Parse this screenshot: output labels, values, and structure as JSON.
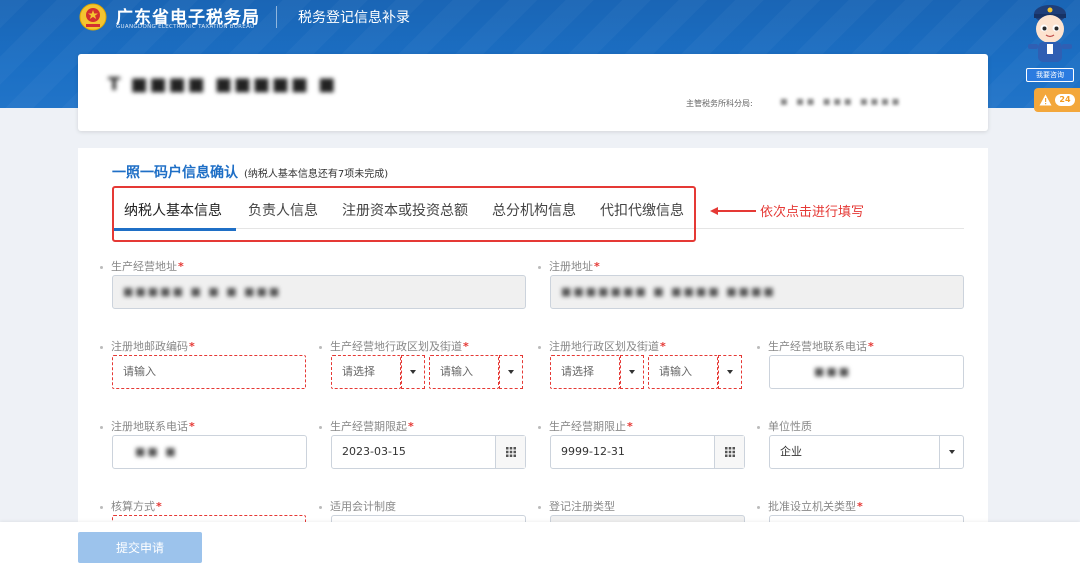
{
  "header": {
    "brand_title": "广东省电子税务局",
    "brand_subtitle": "GUANGDONG ELECTRONIC TAXATION BUREAU",
    "page_title": "税务登记信息补录",
    "consult_label": "我要咨询",
    "alert_count": "24"
  },
  "taxpayer": {
    "name_masked": "T ■■■■ ■■■■■ ■",
    "tax_office_label": "主管税务所科分局:",
    "tax_office_value_masked": "■ ■■ ■■■ ■■■■"
  },
  "section": {
    "title": "一照一码户信息确认",
    "note": "(纳税人基本信息还有7项未完成)"
  },
  "tabs": [
    {
      "label": "纳税人基本信息",
      "active": true
    },
    {
      "label": "负责人信息",
      "active": false
    },
    {
      "label": "注册资本或投资总额",
      "active": false
    },
    {
      "label": "总分机构信息",
      "active": false
    },
    {
      "label": "代扣代缴信息",
      "active": false
    }
  ],
  "annotation": {
    "text": "依次点击进行填写",
    "color": "#e53935"
  },
  "fields": {
    "business_address": {
      "label": "生产经营地址",
      "required": true,
      "value_masked": "■■■■■ ■ ■ ■ ■■■"
    },
    "registered_address": {
      "label": "注册地址",
      "required": true,
      "value_masked": "■■■■■■■ ■ ■■■■ ■■■■"
    },
    "reg_postcode": {
      "label": "注册地邮政编码",
      "required": true,
      "placeholder": "请输入"
    },
    "business_district": {
      "label": "生产经营地行政区划及街道",
      "required": true,
      "select_placeholder": "请选择",
      "input_placeholder": "请输入"
    },
    "reg_district": {
      "label": "注册地行政区划及街道",
      "required": true,
      "select_placeholder": "请选择",
      "input_placeholder": "请输入"
    },
    "business_phone": {
      "label": "生产经营地联系电话",
      "required": true,
      "value_masked": "■■■"
    },
    "reg_phone": {
      "label": "注册地联系电话",
      "required": true,
      "value_masked": "■■ ■"
    },
    "period_start": {
      "label": "生产经营期限起",
      "required": true,
      "value": "2023-03-15"
    },
    "period_end": {
      "label": "生产经营期限止",
      "required": true,
      "value": "9999-12-31"
    },
    "unit_nature": {
      "label": "单位性质",
      "required": false,
      "value": "企业"
    },
    "accounting_method": {
      "label": "核算方式",
      "required": true
    },
    "accounting_system": {
      "label": "适用会计制度",
      "required": false
    },
    "registration_type": {
      "label": "登记注册类型",
      "required": false
    },
    "approval_org_type": {
      "label": "批准设立机关类型",
      "required": true
    }
  },
  "footer": {
    "submit_label": "提交申请"
  },
  "colors": {
    "brand_blue": "#1b6fc4",
    "required_red": "#e53935",
    "submit_disabled": "#9cc3ec"
  }
}
